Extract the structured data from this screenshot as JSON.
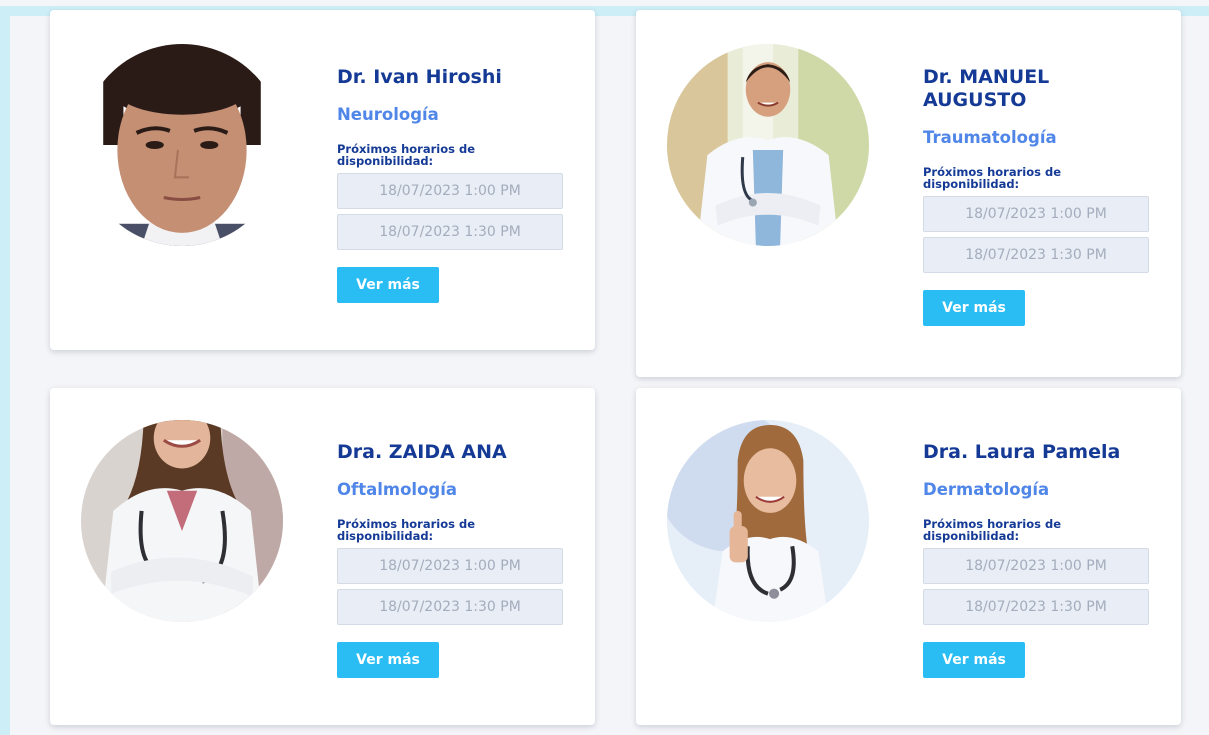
{
  "doctors": [
    {
      "name": "Dr. Ivan Hiroshi",
      "specialty": "Neurología",
      "availability_label": "Próximos horarios de disponibilidad:",
      "slots": [
        "18/07/2023 1:00 PM",
        "18/07/2023 1:30 PM"
      ],
      "button_label": "Ver más"
    },
    {
      "name": "Dr. MANUEL AUGUSTO",
      "specialty": "Traumatología",
      "availability_label": "Próximos horarios de disponibilidad:",
      "slots": [
        "18/07/2023 1:00 PM",
        "18/07/2023 1:30 PM"
      ],
      "button_label": "Ver más"
    },
    {
      "name": "Dra. ZAIDA ANA",
      "specialty": "Oftalmología",
      "availability_label": "Próximos horarios de disponibilidad:",
      "slots": [
        "18/07/2023 1:00 PM",
        "18/07/2023 1:30 PM"
      ],
      "button_label": "Ver más"
    },
    {
      "name": "Dra. Laura Pamela",
      "specialty": "Dermatología",
      "availability_label": "Próximos horarios de disponibilidad:",
      "slots": [
        "18/07/2023 1:00 PM",
        "18/07/2023 1:30 PM"
      ],
      "button_label": "Ver más"
    }
  ],
  "colors": {
    "name": "#153a96",
    "specialty": "#4f86e8",
    "button": "#29bdf4",
    "slot_bg": "#e9edf5",
    "frame": "#cdeef6"
  }
}
